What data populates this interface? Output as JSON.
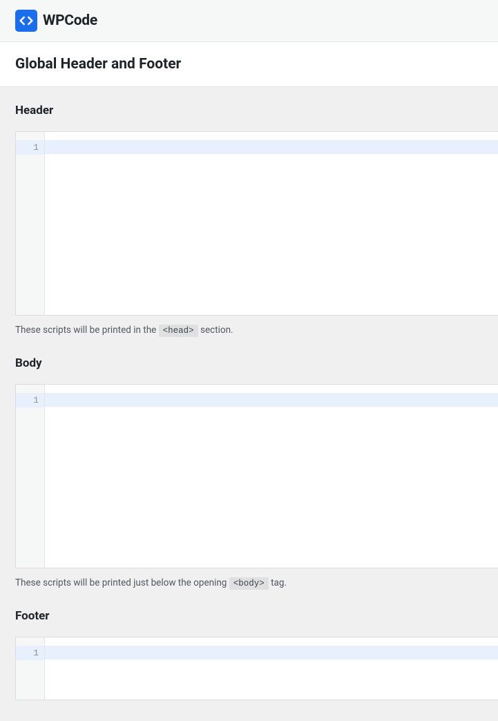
{
  "brand": {
    "name": "WPCode"
  },
  "page": {
    "title": "Global Header and Footer"
  },
  "sections": {
    "header": {
      "heading": "Header",
      "line_number": "1",
      "hint_prefix": "These scripts will be printed in the ",
      "hint_code": "<head>",
      "hint_suffix": " section."
    },
    "body": {
      "heading": "Body",
      "line_number": "1",
      "hint_prefix": "These scripts will be printed just below the opening ",
      "hint_code": "<body>",
      "hint_suffix": " tag."
    },
    "footer": {
      "heading": "Footer",
      "line_number": "1"
    }
  }
}
